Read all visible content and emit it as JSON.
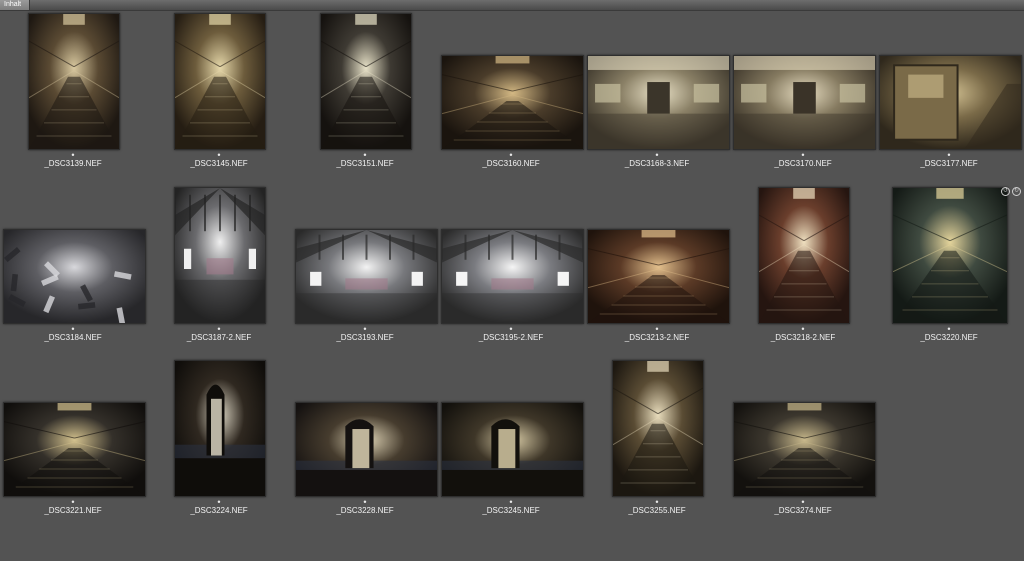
{
  "panel": {
    "tab_label": "Inhalt"
  },
  "rating_glyph": "•",
  "thumbnails": [
    {
      "file": "_DSC3139.NEF",
      "scene": "corridor",
      "base": "#5a4a33",
      "light": "#d9c9a0",
      "dark": "#1e1812"
    },
    {
      "file": "_DSC3145.NEF",
      "scene": "corridor",
      "base": "#6d5c3c",
      "light": "#e6d8aa",
      "dark": "#251d13"
    },
    {
      "file": "_DSC3151.NEF",
      "scene": "corridor",
      "base": "#3e3a33",
      "light": "#e8e2c8",
      "dark": "#15120f"
    },
    {
      "file": "_DSC3160.NEF",
      "scene": "corridor",
      "base": "#4a3c2a",
      "light": "#d4b984",
      "dark": "#1a140e"
    },
    {
      "file": "_DSC3168-3.NEF",
      "scene": "hall",
      "base": "#8a8066",
      "light": "#e9e1c6",
      "dark": "#3b352a"
    },
    {
      "file": "_DSC3170.NEF",
      "scene": "hall",
      "base": "#857a60",
      "light": "#e6dcc0",
      "dark": "#3a3328"
    },
    {
      "file": "_DSC3177.NEF",
      "scene": "door",
      "base": "#7a6a48",
      "light": "#cfbe90",
      "dark": "#2f281c"
    },
    {
      "file": "_DSC3184.NEF",
      "scene": "debris",
      "base": "#5e5e63",
      "light": "#d8d8dc",
      "dark": "#27272a"
    },
    {
      "file": "_DSC3187-2.NEF",
      "scene": "church",
      "base": "#6b6b6e",
      "light": "#efefef",
      "dark": "#232323"
    },
    {
      "file": "_DSC3193.NEF",
      "scene": "church",
      "base": "#77787c",
      "light": "#f3f3f3",
      "dark": "#2a2a2a"
    },
    {
      "file": "_DSC3195-2.NEF",
      "scene": "church",
      "base": "#7a7b80",
      "light": "#f5f5f5",
      "dark": "#2b2b2b"
    },
    {
      "file": "_DSC3213-2.NEF",
      "scene": "corridor",
      "base": "#5b3a26",
      "light": "#e3c08d",
      "dark": "#1f130c"
    },
    {
      "file": "_DSC3218-2.NEF",
      "scene": "corridor",
      "base": "#6a3e2c",
      "light": "#efe0c0",
      "dark": "#251510"
    },
    {
      "file": "_DSC3220.NEF",
      "scene": "corridor",
      "base": "#3f4a40",
      "light": "#e5d59c",
      "dark": "#141a16"
    },
    {
      "file": "_DSC3221.NEF",
      "scene": "corridor",
      "base": "#34302a",
      "light": "#d4c28e",
      "dark": "#100e0c"
    },
    {
      "file": "_DSC3224.NEF",
      "scene": "cell",
      "base": "#2f2820",
      "light": "#d8d2c0",
      "dark": "#0f0d0a"
    },
    {
      "file": "_DSC3228.NEF",
      "scene": "cell",
      "base": "#463c2e",
      "light": "#ddd2b4",
      "dark": "#141110"
    },
    {
      "file": "_DSC3245.NEF",
      "scene": "cell",
      "base": "#3e3628",
      "light": "#d6c9a4",
      "dark": "#12100c"
    },
    {
      "file": "_DSC3255.NEF",
      "scene": "corridor",
      "base": "#5a4c34",
      "light": "#e8dcbc",
      "dark": "#1c1710"
    },
    {
      "file": "_DSC3274.NEF",
      "scene": "corridor",
      "base": "#3c372e",
      "light": "#c9b98c",
      "dark": "#13110e"
    }
  ]
}
